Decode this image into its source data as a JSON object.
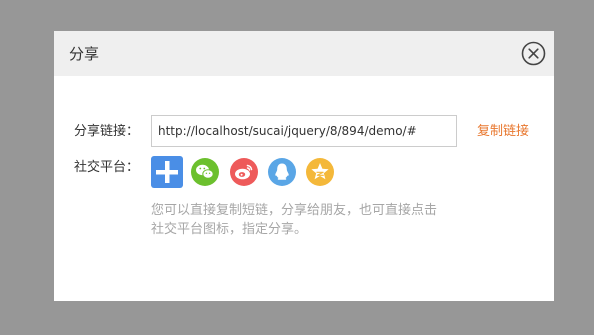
{
  "dialog": {
    "title": "分享",
    "close_icon": "close-circle-icon"
  },
  "share_form": {
    "link_label": "分享链接：",
    "url_value": "http://localhost/sucai/jquery/8/894/demo/#",
    "copy_label": "复制链接",
    "social_label": "社交平台：",
    "platforms": [
      {
        "name": "more",
        "icon": "plus-icon",
        "color": "#4a8ee6"
      },
      {
        "name": "wechat",
        "icon": "wechat-icon",
        "color": "#6cc02e"
      },
      {
        "name": "weibo",
        "icon": "weibo-icon",
        "color": "#ee5a5a"
      },
      {
        "name": "qq",
        "icon": "qq-icon",
        "color": "#5aa6e6"
      },
      {
        "name": "qzone",
        "icon": "qzone-icon",
        "color": "#f4b83a"
      }
    ],
    "hint_line1": "您可以直接复制短链，分享给朋友，也可直接点击",
    "hint_line2": "社交平台图标，指定分享。"
  },
  "colors": {
    "overlay": "#979797",
    "header_bg": "#efefef",
    "accent": "#e8772e"
  }
}
